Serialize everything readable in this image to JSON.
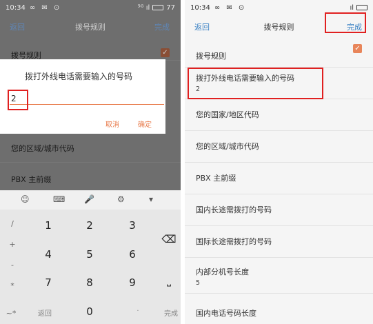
{
  "left": {
    "statusbar": {
      "time": "10:34",
      "icons": "∞ ✉ ⊙",
      "signal": "⁵ᴳ ıl",
      "battery": "77"
    },
    "titlebar": {
      "back": "返回",
      "title": "拨号规则",
      "done": "完成"
    },
    "rows": [
      {
        "title": "拨号规则"
      },
      {
        "title": "您的区域/城市代码"
      },
      {
        "title": "PBX 主前缀"
      }
    ],
    "dialog": {
      "title": "拨打外线电话需要输入的号码",
      "value": "2",
      "cancel": "取消",
      "ok": "确定"
    },
    "keyboard": {
      "toolbar": [
        "☺",
        "⌨",
        "🎤",
        "⚙",
        "▾"
      ],
      "symbols": [
        "/",
        "+",
        "-",
        "*",
        "~*"
      ],
      "keys": [
        [
          "1",
          "2",
          "3"
        ],
        [
          "4",
          "5",
          "6"
        ],
        [
          "7",
          "8",
          "9"
        ]
      ],
      "back": "返回",
      "zero": "0",
      "dot": "·",
      "done": "完成",
      "delete": "⌫",
      "space": "⎵"
    }
  },
  "right": {
    "statusbar": {
      "time": "10:34",
      "icons": "∞ ✉ ⊙",
      "signal": "ıl",
      "battery": ""
    },
    "titlebar": {
      "back": "返回",
      "title": "拨号规则",
      "done": "完成"
    },
    "rows": [
      {
        "title": "拨号规则",
        "value": ""
      },
      {
        "title": "拨打外线电话需要输入的号码",
        "value": "2"
      },
      {
        "title": "您的国家/地区代码",
        "value": ""
      },
      {
        "title": "您的区域/城市代码",
        "value": ""
      },
      {
        "title": "PBX 主前缀",
        "value": ""
      },
      {
        "title": "国内长途需拨打的号码",
        "value": ""
      },
      {
        "title": "国际长途需拨打的号码",
        "value": ""
      },
      {
        "title": "内部分机号长度",
        "value": "5"
      },
      {
        "title": "国内电话号码长度",
        "value": ""
      }
    ],
    "checkmark": "✓"
  }
}
